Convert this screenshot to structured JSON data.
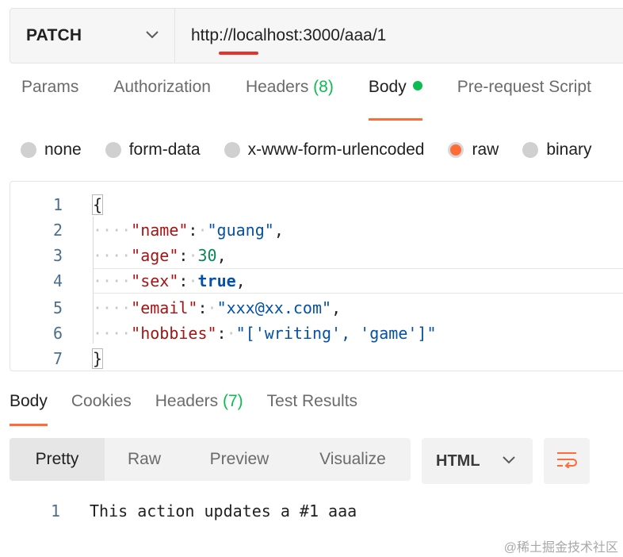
{
  "request": {
    "method": "PATCH",
    "url": "http://localhost:3000/aaa/1"
  },
  "request_tabs": [
    {
      "label": "Params"
    },
    {
      "label": "Authorization"
    },
    {
      "label": "Headers",
      "count": "(8)"
    },
    {
      "label": "Body",
      "active": true
    },
    {
      "label": "Pre-request Script"
    }
  ],
  "body_types": [
    {
      "label": "none"
    },
    {
      "label": "form-data"
    },
    {
      "label": "x-www-form-urlencoded"
    },
    {
      "label": "raw",
      "selected": true
    },
    {
      "label": "binary"
    }
  ],
  "editor": {
    "line_numbers": [
      "1",
      "2",
      "3",
      "4",
      "5",
      "6",
      "7"
    ],
    "open_brace": "{",
    "close_brace": "}",
    "fields": [
      {
        "key": "\"name\"",
        "value": "\"guang\"",
        "type": "string"
      },
      {
        "key": "\"age\"",
        "value": "30",
        "type": "number"
      },
      {
        "key": "\"sex\"",
        "value": "true",
        "type": "bool"
      },
      {
        "key": "\"email\"",
        "value": "\"xxx@xx.com\"",
        "type": "string"
      },
      {
        "key": "\"hobbies\"",
        "value": "\"['writing', 'game']\"",
        "type": "string"
      }
    ]
  },
  "response_tabs": [
    {
      "label": "Body",
      "active": true
    },
    {
      "label": "Cookies"
    },
    {
      "label": "Headers",
      "count": "(7)"
    },
    {
      "label": "Test Results"
    }
  ],
  "view_modes": [
    {
      "label": "Pretty",
      "active": true
    },
    {
      "label": "Raw"
    },
    {
      "label": "Preview"
    },
    {
      "label": "Visualize"
    }
  ],
  "format": {
    "label": "HTML"
  },
  "response": {
    "line": "1",
    "text": "This action updates a #1 aaa"
  },
  "watermark": "@稀土掘金技术社区",
  "colors": {
    "accent": "#ff6c37",
    "success": "#0cbb52",
    "underline": "#e8312a"
  }
}
